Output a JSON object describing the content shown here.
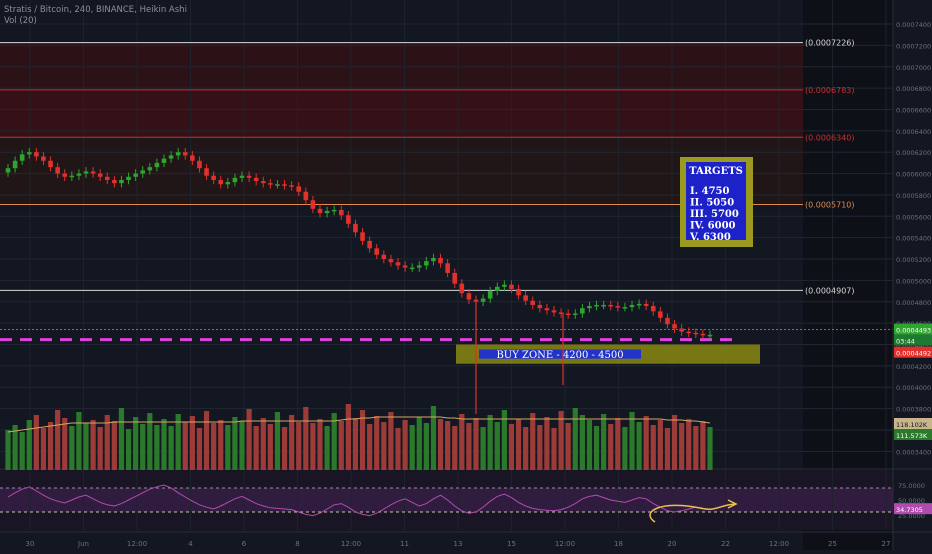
{
  "header": {
    "symbol_line": "Stratis / Bitcoin, 240, BINANCE, Heikin Ashi",
    "volume_line": "Vol (20)"
  },
  "colors": {
    "background": "#131722",
    "up_candle": "#2ea52e",
    "down_candle": "#e0312d",
    "up_volume": "#2b7a2b",
    "down_volume": "#9c3b38",
    "buy_zone": "#8a8a12",
    "targets_box_border": "#9a9a20",
    "targets_box_fill": "#1d22c8",
    "dashed_support": "#e040e0",
    "rsi_line": "#b04cb0"
  },
  "chart_data": {
    "type": "candlestick",
    "style": "Heikin Ashi",
    "symbol": "Stratis / Bitcoin",
    "exchange": "BINANCE",
    "interval": "240",
    "price_axis": {
      "range": [
        0.00033,
        0.000755
      ],
      "ticks": [
        "0.0007400",
        "0.0007200",
        "0.0007000",
        "0.0006800",
        "0.0006600",
        "0.0006400",
        "0.0006200",
        "0.0006000",
        "0.0005800",
        "0.0005600",
        "0.0005400",
        "0.0005200",
        "0.0005000",
        "0.0004800",
        "0.0004600",
        "0.0004400",
        "0.0004200",
        "0.0004000",
        "0.0003800",
        "0.0003600",
        "0.0003400"
      ],
      "tick_values": [
        0.00074,
        0.00072,
        0.0007,
        0.00068,
        0.00066,
        0.00064,
        0.00062,
        0.0006,
        0.00058,
        0.00056,
        0.00054,
        0.00052,
        0.0005,
        0.00048,
        0.00046,
        0.00044,
        0.00042,
        0.0004,
        0.00038,
        0.00036,
        0.00034
      ],
      "last_price_label": "0.0004493",
      "last_price_time_label": "03:44",
      "marker_label": "0.0004492",
      "volume_labels": [
        "118.102K",
        "111.573K"
      ]
    },
    "time_axis": {
      "labels": [
        "30",
        "Jun",
        "12:00",
        "4",
        "6",
        "8",
        "12:00",
        "11",
        "13",
        "15",
        "12:00",
        "18",
        "20",
        "22",
        "12:00",
        "25",
        "27"
      ]
    },
    "levels": [
      {
        "label": "(0.0007226)",
        "value": 0.0007226,
        "color": "#d8d8d8"
      },
      {
        "label": "(0.0006783)",
        "value": 0.0006783,
        "color": "#c93030"
      },
      {
        "label": "(0.0006340)",
        "value": 0.000634,
        "color": "#c93030"
      },
      {
        "label": "(0.0005710)",
        "value": 0.000571,
        "color": "#e08a50"
      },
      {
        "label": "(0.0004907)",
        "value": 0.0004907,
        "color": "#d8d8d8"
      }
    ],
    "support_value": 0.0004445,
    "buy_zone": {
      "label": "BUY ZONE - 4200 - 4500",
      "low": 0.000422,
      "high": 0.00044
    },
    "targets": {
      "title": "TARGETS",
      "items": [
        "I. 4750",
        "II. 5050",
        "III. 5700",
        "IV. 6000",
        "V. 6300"
      ]
    },
    "closes": [
      0.000605,
      0.000612,
      0.000618,
      0.00062,
      0.000616,
      0.000612,
      0.000606,
      0.0006,
      0.000597,
      0.000598,
      0.0006,
      0.000602,
      0.0006,
      0.000597,
      0.000594,
      0.000591,
      0.000594,
      0.000597,
      0.0006,
      0.000603,
      0.000606,
      0.00061,
      0.000614,
      0.000617,
      0.00062,
      0.000617,
      0.000612,
      0.000605,
      0.000598,
      0.000594,
      0.00059,
      0.000592,
      0.000596,
      0.000598,
      0.000596,
      0.000593,
      0.000591,
      0.00059,
      0.00059,
      0.000589,
      0.000588,
      0.000583,
      0.000575,
      0.000567,
      0.000563,
      0.000565,
      0.000566,
      0.000561,
      0.000553,
      0.000545,
      0.000537,
      0.00053,
      0.000524,
      0.00052,
      0.000517,
      0.000514,
      0.000512,
      0.000512,
      0.000514,
      0.000518,
      0.000521,
      0.000516,
      0.000507,
      0.000497,
      0.000488,
      0.000482,
      0.00048,
      0.000483,
      0.00049,
      0.000494,
      0.000496,
      0.000492,
      0.000486,
      0.000481,
      0.000477,
      0.000474,
      0.000472,
      0.00047,
      0.000469,
      0.000468,
      0.000469,
      0.000474,
      0.000476,
      0.000477,
      0.000477,
      0.000476,
      0.000475,
      0.000475,
      0.000477,
      0.000478,
      0.000476,
      0.000471,
      0.000465,
      0.000459,
      0.000455,
      0.000452,
      0.000451,
      0.00045,
      0.000449,
      0.000449
    ],
    "volumes": [
      40,
      45,
      38,
      50,
      55,
      42,
      48,
      60,
      52,
      44,
      58,
      47,
      50,
      43,
      55,
      49,
      62,
      41,
      53,
      46,
      57,
      45,
      51,
      44,
      56,
      48,
      54,
      42,
      59,
      47,
      50,
      45,
      53,
      49,
      61,
      44,
      52,
      46,
      58,
      43,
      55,
      48,
      63,
      47,
      51,
      44,
      57,
      49,
      66,
      52,
      60,
      46,
      54,
      48,
      58,
      42,
      50,
      45,
      53,
      47,
      64,
      51,
      49,
      44,
      56,
      47,
      52,
      43,
      55,
      48,
      60,
      46,
      51,
      43,
      57,
      45,
      53,
      42,
      59,
      47,
      62,
      55,
      50,
      44,
      56,
      46,
      52,
      43,
      58,
      48,
      54,
      45,
      50,
      42,
      55,
      47,
      51,
      44,
      49,
      43
    ],
    "volume_ma": [
      38,
      39,
      40,
      41,
      42,
      43,
      44,
      45,
      46,
      47,
      47,
      47,
      47,
      47,
      47,
      48,
      48,
      48,
      48,
      48,
      48,
      48,
      48,
      48,
      48,
      48,
      48,
      48,
      48,
      48,
      48,
      48,
      48,
      49,
      49,
      49,
      49,
      49,
      49,
      49,
      49,
      49,
      49,
      49,
      49,
      49,
      49,
      50,
      51,
      51,
      52,
      52,
      53,
      53,
      53,
      53,
      53,
      53,
      53,
      53,
      53,
      53,
      52,
      52,
      51,
      51,
      51,
      51,
      51,
      51,
      51,
      51,
      51,
      51,
      51,
      51,
      51,
      51,
      51,
      51,
      51,
      51,
      51,
      51,
      51,
      51,
      51,
      51,
      51,
      51,
      51,
      51,
      51,
      50,
      50,
      50,
      49,
      49,
      48,
      47
    ],
    "rsi": {
      "ticks": [
        "75.0000",
        "50.0000",
        "25.0000"
      ],
      "tick_values": [
        75,
        50,
        25
      ],
      "upper_band": 70,
      "lower_band": 30,
      "current_label": "34.7305",
      "current_value": 34.73,
      "values": [
        55,
        62,
        68,
        72,
        65,
        58,
        52,
        48,
        45,
        50,
        55,
        58,
        52,
        46,
        42,
        40,
        44,
        50,
        56,
        62,
        68,
        72,
        75,
        70,
        62,
        55,
        48,
        42,
        38,
        35,
        40,
        46,
        52,
        56,
        50,
        44,
        40,
        37,
        36,
        35,
        34,
        30,
        26,
        24,
        28,
        35,
        42,
        44,
        38,
        30,
        26,
        24,
        28,
        35,
        42,
        48,
        52,
        46,
        40,
        44,
        52,
        58,
        50,
        40,
        32,
        28,
        30,
        38,
        48,
        56,
        60,
        54,
        46,
        40,
        36,
        34,
        33,
        32,
        34,
        38,
        44,
        52,
        56,
        58,
        54,
        50,
        48,
        46,
        50,
        54,
        52,
        44,
        38,
        32,
        30,
        32,
        35,
        38,
        36,
        34.73
      ]
    }
  }
}
